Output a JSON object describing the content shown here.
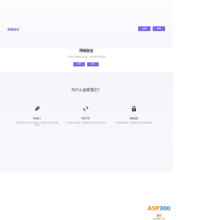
{
  "header": {
    "logo_text": "网络验证",
    "buttons": [
      "注册",
      "登录"
    ]
  },
  "hero": {
    "title": "网络验证",
    "subtitle": "安全稳定的网络验证系统，为您的软件保驾护航",
    "buttons": [
      "注册",
      "登录"
    ]
  },
  "features": {
    "title": "为什么选择我们？",
    "items": [
      {
        "icon": "rocket-icon",
        "name": "快速接入",
        "desc": "提供多种语言接入示例，简单快捷，几分钟即可完成软件的网络验证接入"
      },
      {
        "icon": "sync-icon",
        "name": "稳定可靠",
        "desc": "多节点部署，高速稳定，保证您的软件验证服务持续稳定运行"
      },
      {
        "icon": "lock-icon",
        "name": "数据加密",
        "desc": "采用多重加密算法，数据传输安全加密，有效防止破解"
      }
    ]
  },
  "watermark": {
    "logo_a": "ASP",
    "logo_b": "300",
    "logo_c": "源码",
    "url": "asp300.net"
  },
  "colors": {
    "accent": "#7b6cf0",
    "icon": "#4a4a4a"
  }
}
